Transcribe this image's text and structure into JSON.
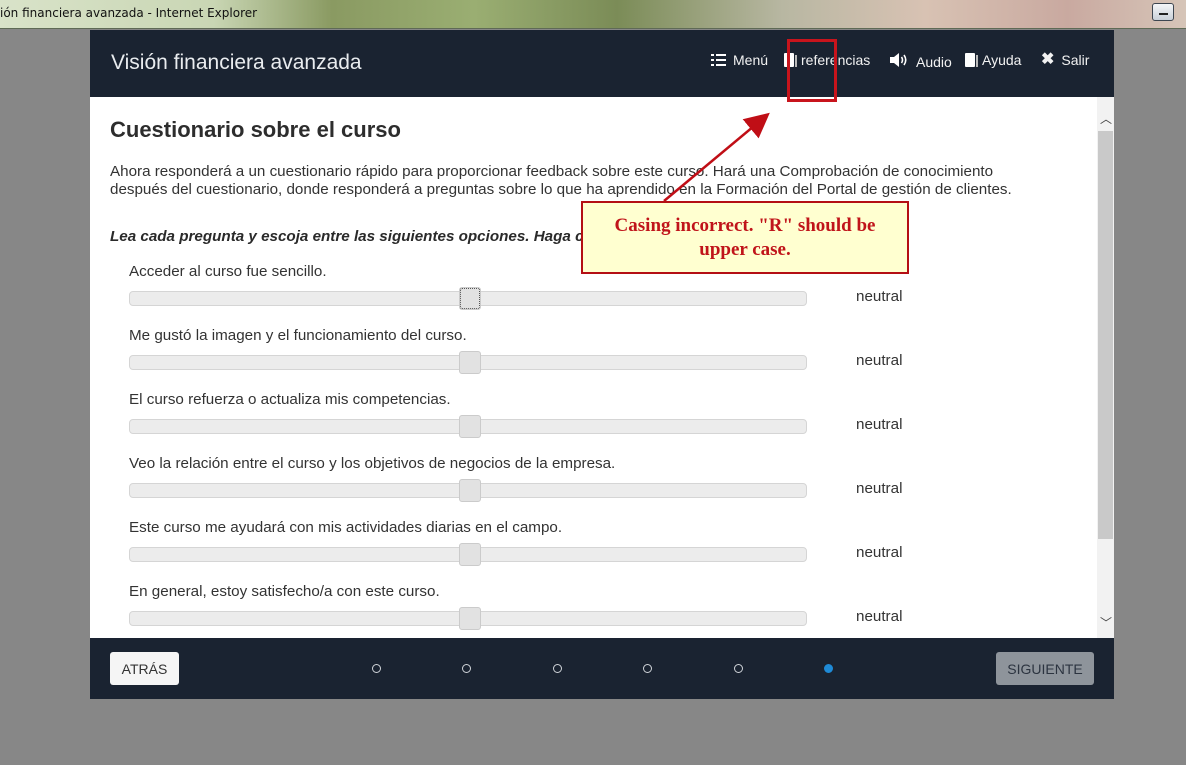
{
  "window": {
    "title": "ión financiera avanzada - Internet Explorer"
  },
  "header": {
    "course_title": "Visión financiera avanzada",
    "nav": {
      "menu": "Menú",
      "references": "referencias",
      "audio": "Audio",
      "help": "Ayuda",
      "exit": "Salir"
    },
    "icons": [
      "list-icon",
      "book-icon",
      "speaker-icon",
      "book-icon",
      "close-icon"
    ]
  },
  "content": {
    "title": "Cuestionario sobre el curso",
    "intro": "Ahora responderá a un cuestionario rápido para proporcionar feedback sobre este curso. Hará una Comprobación de conocimiento después del cuestionario, donde responderá a preguntas sobre lo que ha aprendido en la Formación del Portal de gestión de clientes.",
    "instruction": "Lea cada pregunta y escoja entre las siguientes opciones. Haga cli",
    "questions": [
      {
        "text": "Acceder al curso fue sencillo.",
        "value": "neutral",
        "level": 0.5
      },
      {
        "text": "Me gustó la imagen y el funcionamiento del curso.",
        "value": "neutral",
        "level": 0.5
      },
      {
        "text": "El curso refuerza o actualiza mis competencias.",
        "value": "neutral",
        "level": 0.5
      },
      {
        "text": "Veo la relación entre el curso y los objetivos de negocios de la empresa.",
        "value": "neutral",
        "level": 0.5
      },
      {
        "text": "Este curso me ayudará con mis actividades diarias en el campo.",
        "value": "neutral",
        "level": 0.5
      },
      {
        "text": "En general, estoy satisfecho/a con este curso.",
        "value": "neutral",
        "level": 0.5
      }
    ]
  },
  "footer": {
    "back": "ATRÁS",
    "next": "SIGUIENTE",
    "pages": 6,
    "current_page": 6
  },
  "annotation": {
    "callout": "Casing incorrect. \"R\" should be upper case.",
    "color": "#c0141a"
  },
  "colors": {
    "header_bg": "#1a2331",
    "active_dot": "#1f8ad6",
    "backdrop": "#878787"
  }
}
